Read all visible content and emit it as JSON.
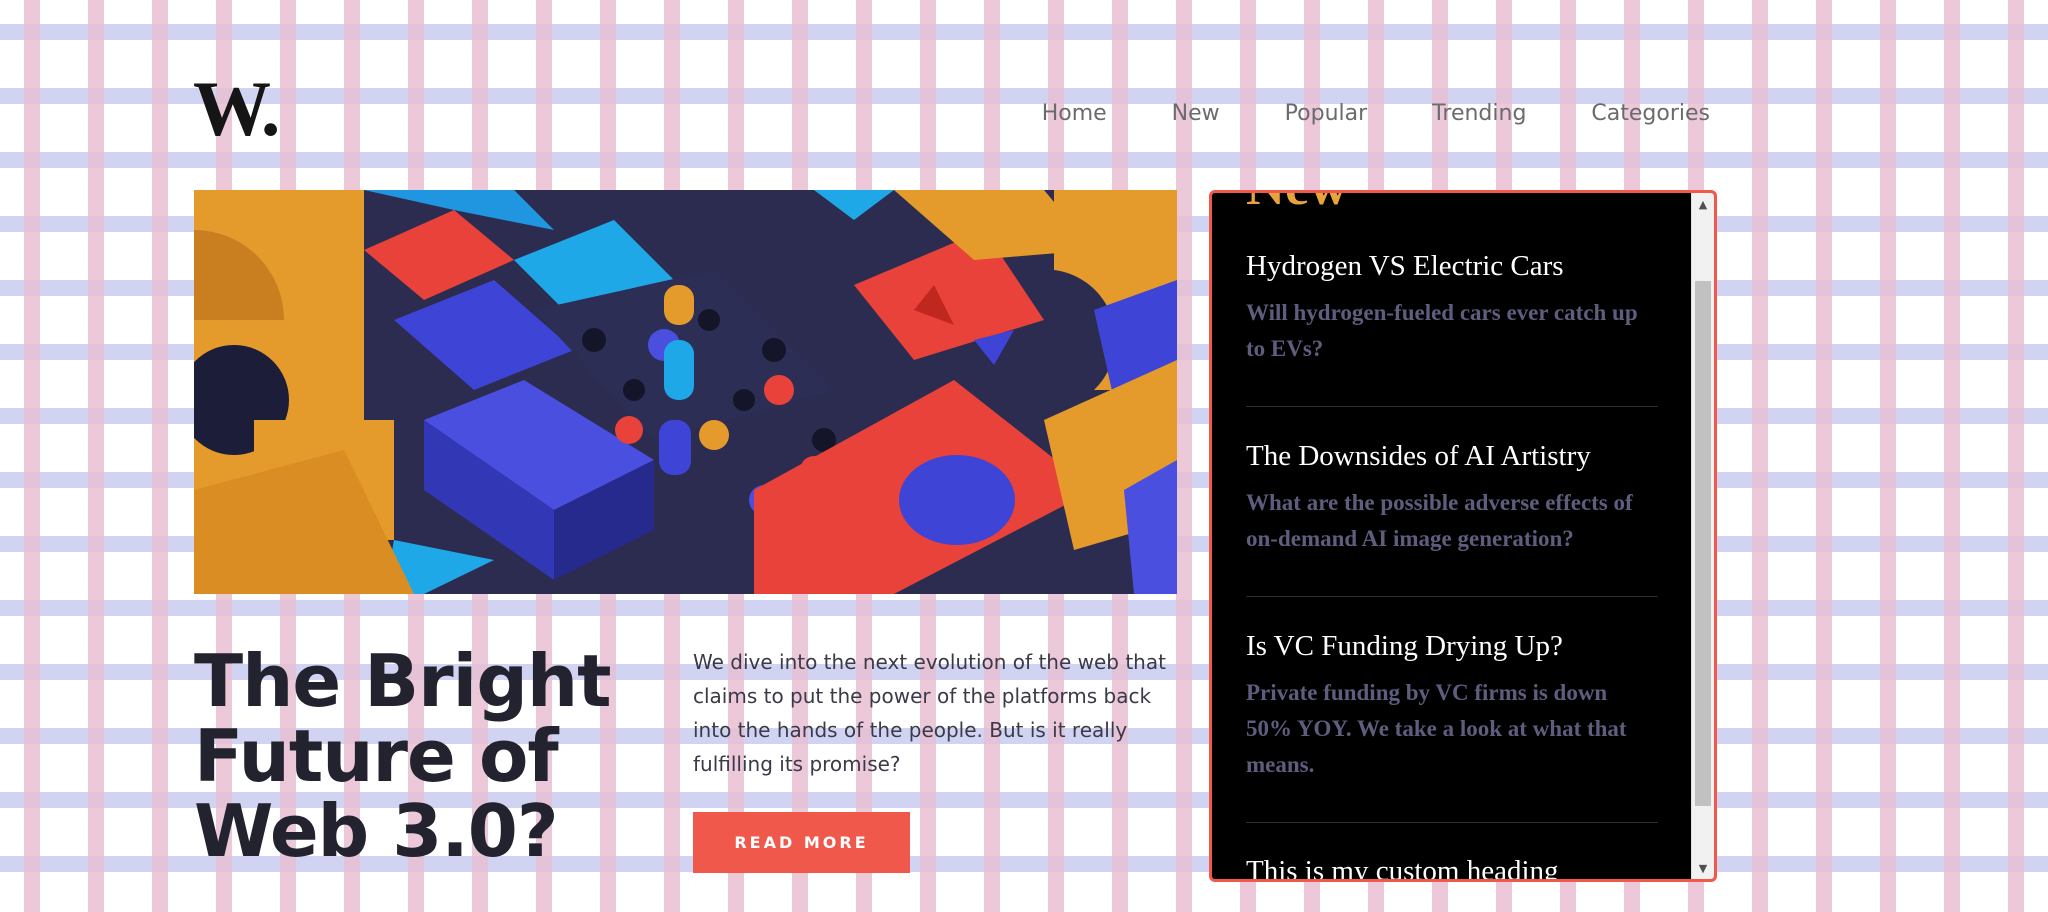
{
  "header": {
    "logo": "W.",
    "nav": [
      "Home",
      "New",
      "Popular",
      "Trending",
      "Categories"
    ]
  },
  "hero": {
    "title": "The Bright Future of Web 3.0?",
    "description": "We dive into the next evolution of the web that claims to put the power of the platforms back into the hands of the people. But is it really fulfilling its promise?",
    "cta_label": "READ MORE"
  },
  "sidebar": {
    "heading": "New",
    "articles": [
      {
        "title": "Hydrogen VS Electric Cars",
        "summary": "Will hydrogen-fueled cars ever catch up to EVs?"
      },
      {
        "title": "The Downsides of AI Artistry",
        "summary": "What are the possible adverse effects of on-demand AI image generation?"
      },
      {
        "title": "Is VC Funding Drying Up?",
        "summary": "Private funding by VC firms is down 50% YOY. We take a look at what that means."
      },
      {
        "title": "This is my custom heading",
        "summary": ""
      }
    ]
  },
  "colors": {
    "accent": "#f0584c",
    "panel_heading": "#e9a33c",
    "panel_background": "#000000",
    "summary_text": "#5e5d7e",
    "title_text": "#232330"
  },
  "icons": {
    "scroll_up": "triangle-up-icon",
    "scroll_down": "triangle-down-icon"
  }
}
